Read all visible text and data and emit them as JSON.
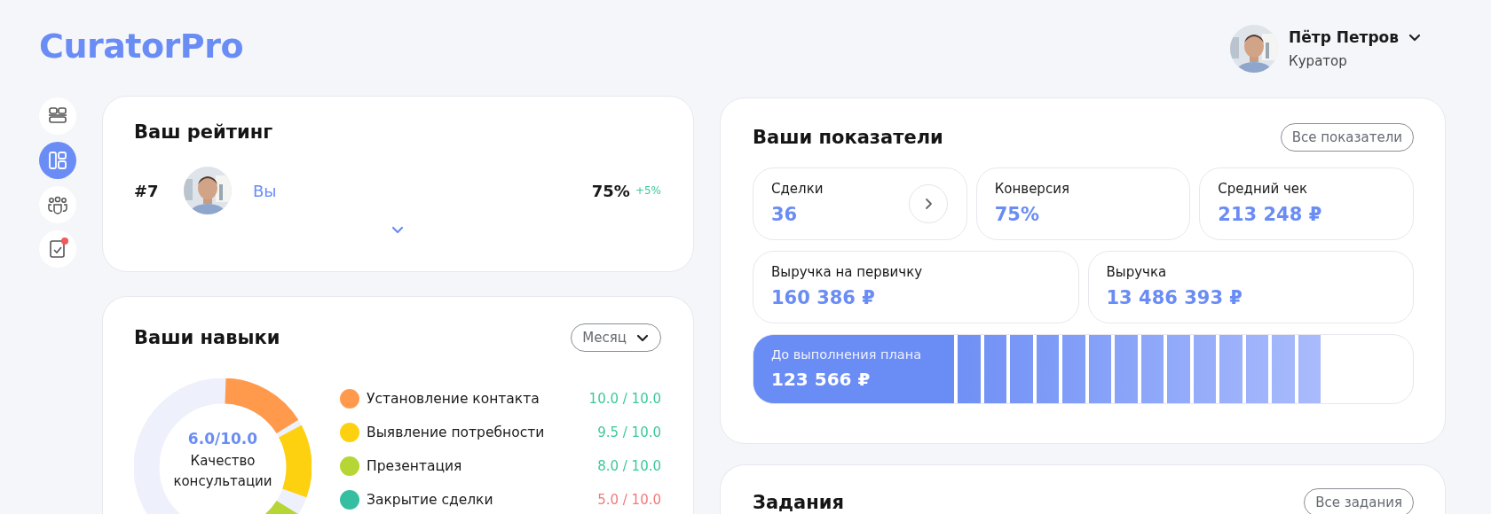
{
  "brand": "CuratorPro",
  "user": {
    "name": "Пётр Петров",
    "role": "Куратор"
  },
  "sidebar": {
    "items": [
      {
        "kind": "cards",
        "selected": false,
        "notification": false
      },
      {
        "kind": "layout",
        "selected": true,
        "notification": false
      },
      {
        "kind": "team",
        "selected": false,
        "notification": false
      },
      {
        "kind": "tasks",
        "selected": false,
        "notification": true
      }
    ]
  },
  "rating": {
    "title": "Ваш рейтинг",
    "place": "#7",
    "name": "Вы",
    "percent": "75%",
    "change": "+5%"
  },
  "skills": {
    "title": "Ваши навыки",
    "period": "Месяц",
    "total": "6.0/10.0",
    "caption": "Качество консультации",
    "items": [
      {
        "name": "Установление контакта",
        "score": "10.0 / 10.0",
        "color": "#ff9a4d",
        "low": false
      },
      {
        "name": "Выявление потребности",
        "score": "9.5 / 10.0",
        "color": "#fdd10f",
        "low": false
      },
      {
        "name": "Презентация",
        "score": "8.0 / 10.0",
        "color": "#b5d634",
        "low": false
      },
      {
        "name": "Закрытие сделки",
        "score": "5.0 / 10.0",
        "color": "#35bfa0",
        "low": true
      }
    ]
  },
  "metrics": {
    "title": "Ваши показатели",
    "all_button": "Все показатели",
    "rows": [
      [
        {
          "label": "Сделки",
          "value": "36",
          "link": true
        },
        {
          "label": "Конверсия",
          "value": "75%",
          "link": false
        },
        {
          "label": "Средний чек",
          "value": "213 248 ₽",
          "link": false
        }
      ],
      [
        {
          "label": "Выручка на первичку",
          "value": "160 386 ₽",
          "link": false
        },
        {
          "label": "Выручка",
          "value": "13 486 393 ₽",
          "link": false
        }
      ]
    ],
    "plan": {
      "label": "До выполнения плана",
      "value": "123 566 ₽"
    }
  },
  "tasks": {
    "title": "Задания",
    "all_button": "Все задания"
  }
}
